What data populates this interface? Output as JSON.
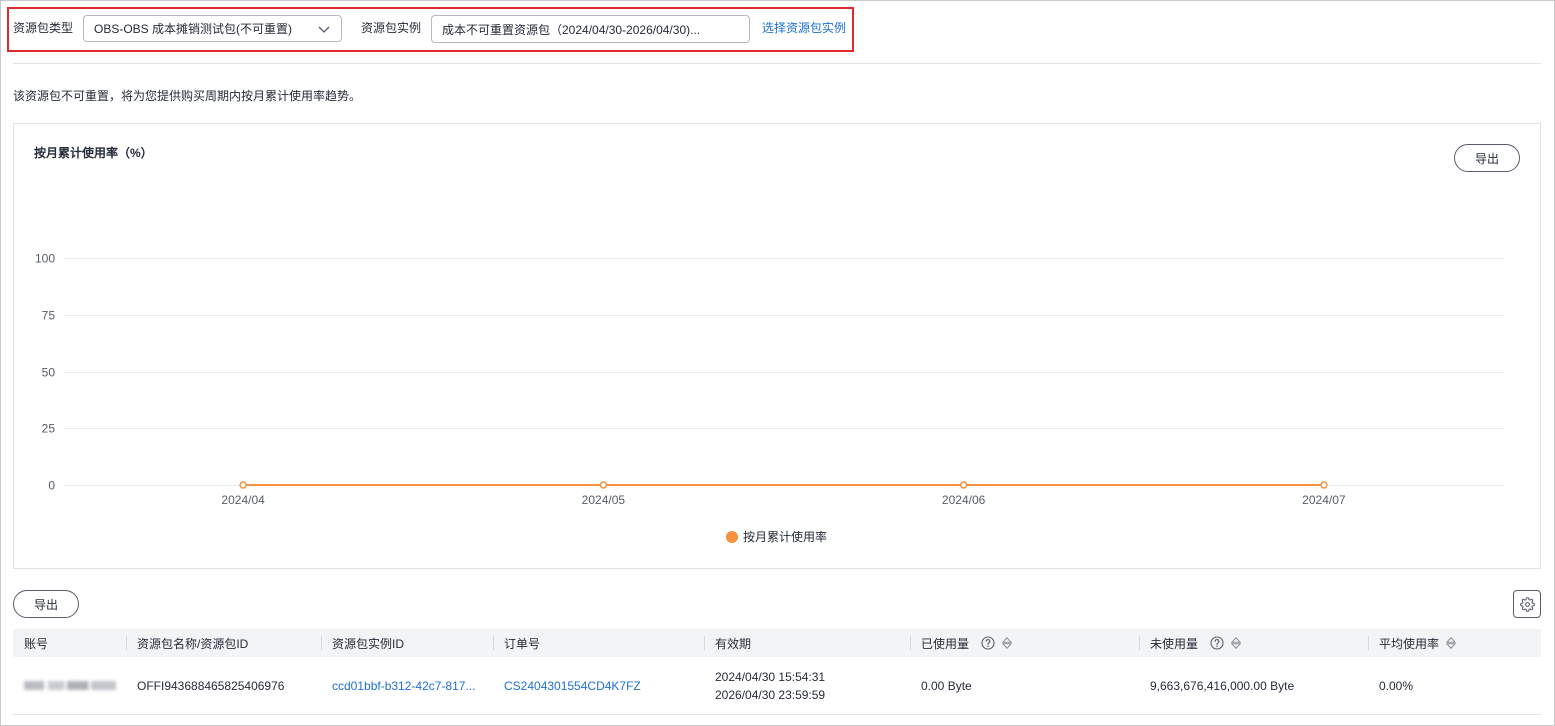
{
  "filter": {
    "package_type_label": "资源包类型",
    "package_type_value": "OBS-OBS 成本摊销测试包(不可重置)",
    "instance_label": "资源包实例",
    "instance_value": "成本不可重置资源包（2024/04/30-2026/04/30)...",
    "select_instance_link": "选择资源包实例"
  },
  "notice": "该资源包不可重置，将为您提供购买周期内按月累计使用率趋势。",
  "chart_card": {
    "export_label": "导出"
  },
  "chart_data": {
    "type": "line",
    "title": "按月累计使用率（%）",
    "categories": [
      "2024/04",
      "2024/05",
      "2024/06",
      "2024/07"
    ],
    "series": [
      {
        "name": "按月累计使用率",
        "values": [
          0,
          0,
          0,
          0
        ],
        "color": "#f6913d"
      }
    ],
    "yticks": [
      0,
      25,
      50,
      75,
      100
    ],
    "ylim": [
      0,
      100
    ],
    "grid": true,
    "legend_position": "bottom-center"
  },
  "table_toolbar": {
    "export_label": "导出"
  },
  "table": {
    "columns": [
      {
        "label": "账号"
      },
      {
        "label": "资源包名称/资源包ID"
      },
      {
        "label": "资源包实例ID"
      },
      {
        "label": "订单号"
      },
      {
        "label": "有效期"
      },
      {
        "label": "已使用量",
        "help": true,
        "sortable": true
      },
      {
        "label": "未使用量",
        "help": true,
        "sortable": true
      },
      {
        "label": "平均使用率",
        "sortable": true
      }
    ],
    "rows": [
      {
        "package_id": "OFFI943688465825406976",
        "instance_id": "ccd01bbf-b312-42c7-817...",
        "order_no": "CS2404301554CD4K7FZ",
        "validity_start": "2024/04/30 15:54:31",
        "validity_end": "2026/04/30 23:59:59",
        "used": "0.00 Byte",
        "unused": "9,663,676,416,000.00 Byte",
        "avg_rate": "0.00%"
      }
    ]
  },
  "icons": {
    "select_chevron": "chevron-down-icon",
    "help": "question-circle-icon",
    "sort": "sort-icon",
    "settings": "gear-icon"
  },
  "colors": {
    "highlight_frame": "#e32a2a",
    "link": "#1e6fd6",
    "series": "#f6913d",
    "table_header_bg": "#f3f4f6"
  }
}
